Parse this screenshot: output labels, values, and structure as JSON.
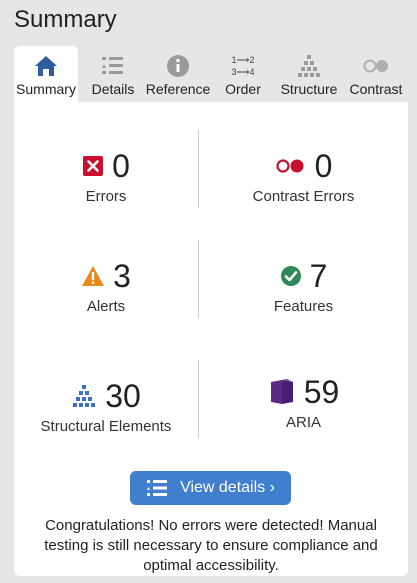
{
  "page": {
    "title": "Summary"
  },
  "tabs": [
    {
      "label": "Summary",
      "icon": "home-icon",
      "active": true
    },
    {
      "label": "Details",
      "icon": "list-icon",
      "active": false
    },
    {
      "label": "Reference",
      "icon": "info-icon",
      "active": false
    },
    {
      "label": "Order",
      "icon": "order-icon",
      "active": false,
      "icon_text_top": "1⟶2",
      "icon_text_bottom": "3⟶4"
    },
    {
      "label": "Structure",
      "icon": "hierarchy-icon",
      "active": false
    },
    {
      "label": "Contrast",
      "icon": "contrast-icon",
      "active": false
    }
  ],
  "stats": {
    "errors": {
      "value": "0",
      "label": "Errors",
      "icon": "error-icon"
    },
    "contrast_errors": {
      "value": "0",
      "label": "Contrast Errors",
      "icon": "contrast-error-icon"
    },
    "alerts": {
      "value": "3",
      "label": "Alerts",
      "icon": "alert-icon"
    },
    "features": {
      "value": "7",
      "label": "Features",
      "icon": "feature-check-icon"
    },
    "structural": {
      "value": "30",
      "label": "Structural Elements",
      "icon": "structure-icon"
    },
    "aria": {
      "value": "59",
      "label": "ARIA",
      "icon": "aria-icon"
    }
  },
  "view_button": {
    "label": "View details ›"
  },
  "message": "Congratulations! No errors were detected! Manual testing is still necessary to ensure compliance and optimal accessibility.",
  "colors": {
    "error": "#c8102e",
    "alert": "#e8891a",
    "feature": "#2e8b57",
    "structure": "#3a72c8",
    "aria": "#5b2a86",
    "button": "#3f7fce",
    "tab_icon_active": "#2f5e9e",
    "tab_icon_inactive": "#9a9a9a"
  }
}
